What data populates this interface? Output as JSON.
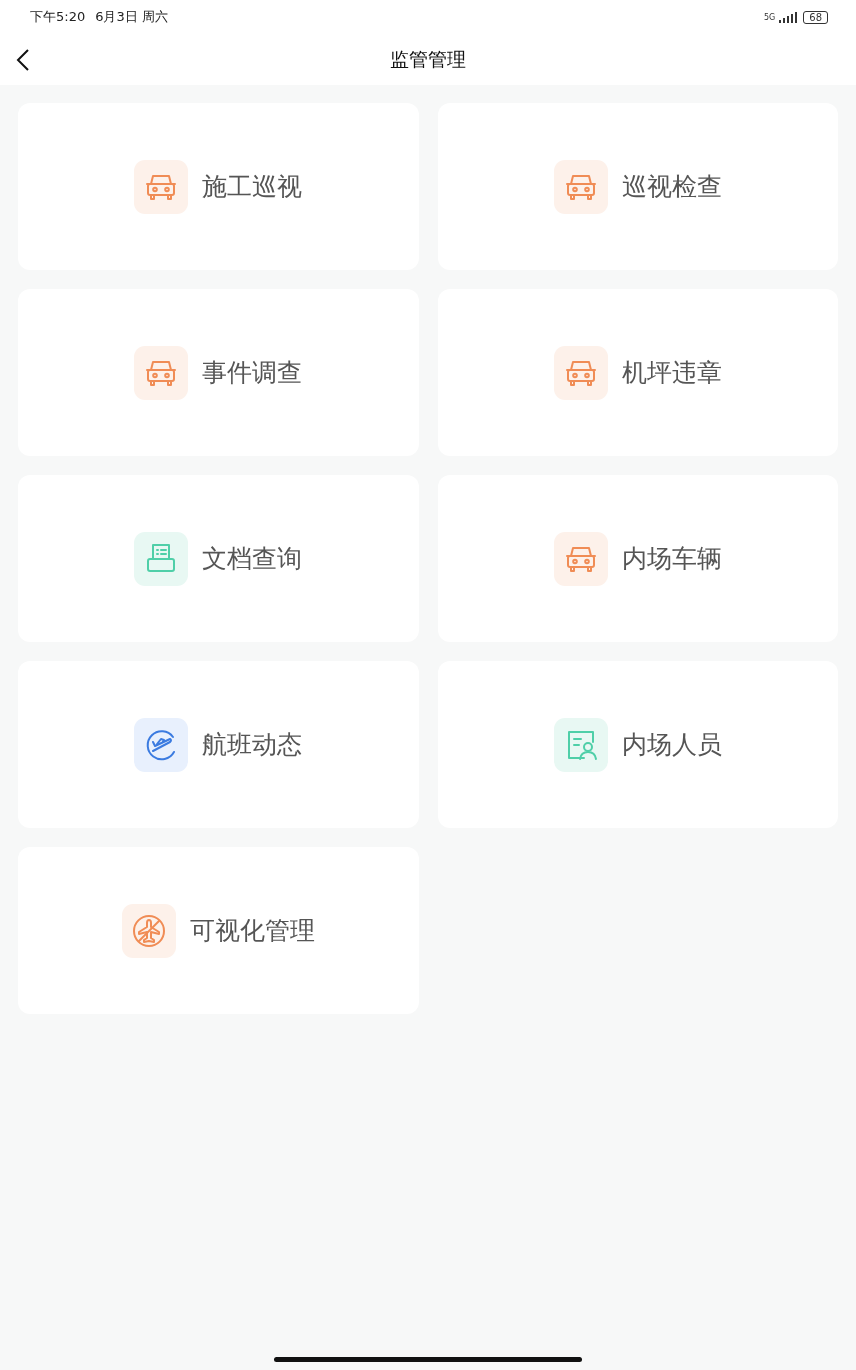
{
  "status_bar": {
    "time": "下午5:20",
    "date": "6月3日 周六",
    "network": "5G",
    "battery": "68"
  },
  "header": {
    "title": "监管管理"
  },
  "items": [
    {
      "label": "施工巡视",
      "kind": "car"
    },
    {
      "label": "巡视检查",
      "kind": "car"
    },
    {
      "label": "事件调查",
      "kind": "car"
    },
    {
      "label": "机坪违章",
      "kind": "car"
    },
    {
      "label": "文档查询",
      "kind": "document"
    },
    {
      "label": "内场车辆",
      "kind": "car"
    },
    {
      "label": "航班动态",
      "kind": "flight"
    },
    {
      "label": "内场人员",
      "kind": "person"
    },
    {
      "label": "可视化管理",
      "kind": "plane-off"
    }
  ]
}
